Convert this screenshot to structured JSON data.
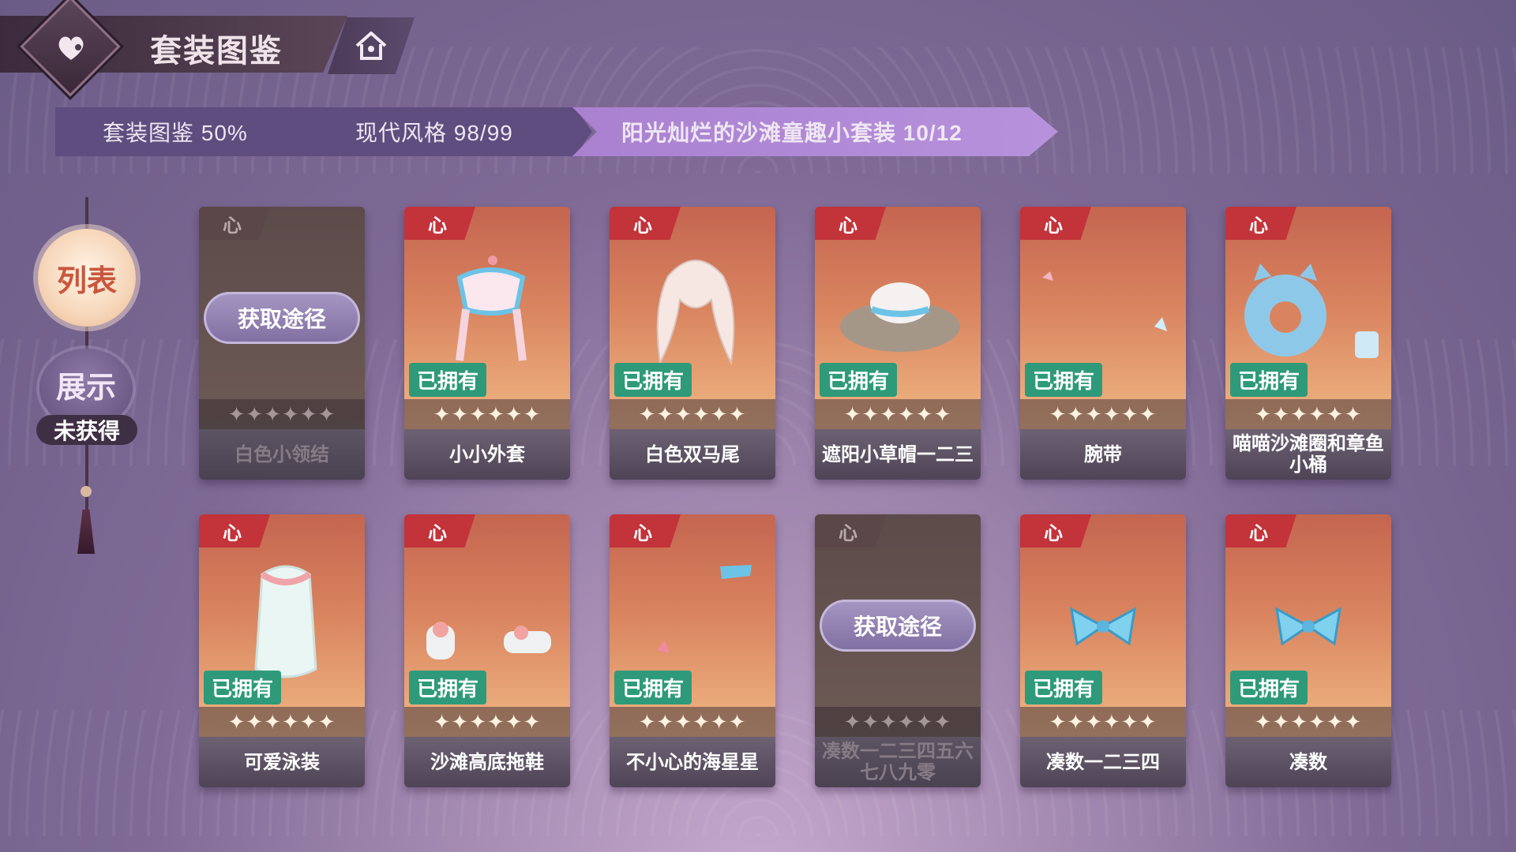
{
  "header": {
    "title": "套装图鉴",
    "home_icon": "home-icon"
  },
  "breadcrumb": [
    {
      "label": "套装图鉴 50%"
    },
    {
      "label": "现代风格 98/99"
    },
    {
      "label": "阳光灿烂的沙滩童趣小套装  10/12"
    }
  ],
  "side": {
    "list_label": "列表",
    "show_label": "展示",
    "unobtained_label": "未获得"
  },
  "card_common": {
    "heart": "心",
    "owned": "已拥有",
    "obtain": "获取途径",
    "stars": "✦✦✦✦✦✦"
  },
  "cards": [
    {
      "name": "白色小领结",
      "status": "locked"
    },
    {
      "name": "小小外套",
      "status": "owned"
    },
    {
      "name": "白色双马尾",
      "status": "owned"
    },
    {
      "name": "遮阳小草帽一二三",
      "status": "owned"
    },
    {
      "name": "腕带",
      "status": "owned"
    },
    {
      "name": "喵喵沙滩圈和章鱼小桶",
      "status": "owned"
    },
    {
      "name": "可爱泳装",
      "status": "owned"
    },
    {
      "name": "沙滩高底拖鞋",
      "status": "owned"
    },
    {
      "name": "不小心的海星星",
      "status": "owned"
    },
    {
      "name": "凑数一二三四五六七八九零",
      "status": "locked"
    },
    {
      "name": "凑数一二三四",
      "status": "owned"
    },
    {
      "name": "凑数",
      "status": "owned"
    }
  ],
  "colors": {
    "owned_badge": "#2e9a79",
    "heart_tag": "#c3333a",
    "active_crumb": "#b792dc"
  }
}
